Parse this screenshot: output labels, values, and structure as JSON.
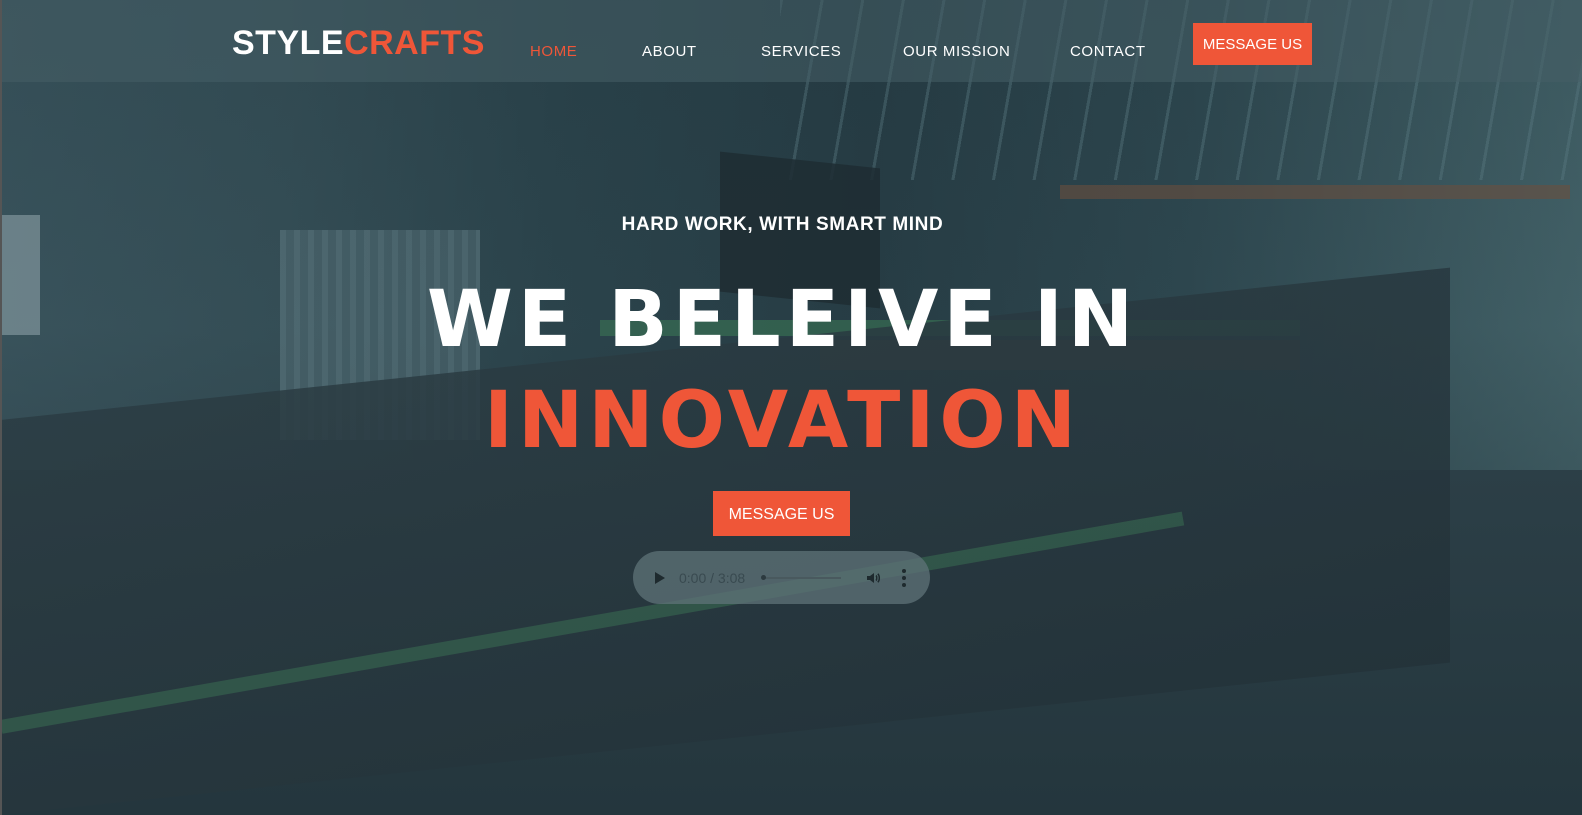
{
  "brand": {
    "part1": "STYLE",
    "part2": "CRAFTS",
    "accent": "#ef5638"
  },
  "nav": {
    "items": [
      {
        "label": "HOME",
        "active": true
      },
      {
        "label": "ABOUT",
        "active": false
      },
      {
        "label": "SERVICES",
        "active": false
      },
      {
        "label": "OUR MISSION",
        "active": false
      },
      {
        "label": "CONTACT",
        "active": false
      }
    ],
    "cta_label": "MESSAGE US"
  },
  "hero": {
    "tagline": "HARD WORK, WITH SMART MIND",
    "headline_line1": "WE BELEIVE IN",
    "headline_line2": "INNOVATION",
    "cta_label": "MESSAGE US"
  },
  "audio_player": {
    "time": "0:00 / 3:08",
    "progress": 0,
    "icons": [
      "play-icon",
      "volume-icon",
      "more-options-icon"
    ]
  }
}
